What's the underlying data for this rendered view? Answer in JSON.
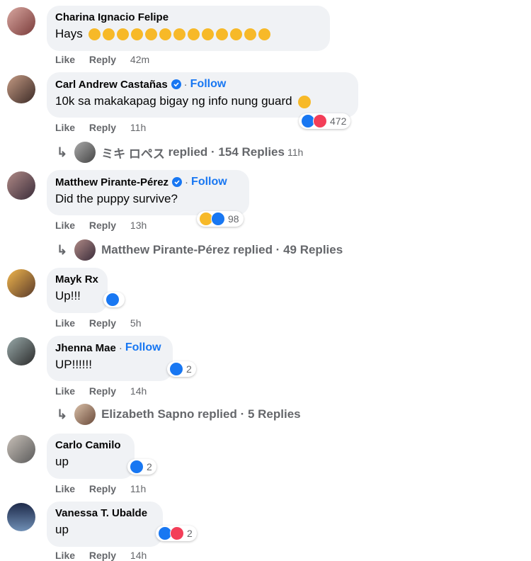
{
  "comments": [
    {
      "name": "Charina Ignacio Felipe",
      "verified": false,
      "follow": "",
      "text": "Hays",
      "emojis": 13,
      "like": "Like",
      "reply": "Reply",
      "time": "42m",
      "reactions": null,
      "replies": null
    },
    {
      "name": "Carl Andrew Castañas",
      "verified": true,
      "follow": "Follow",
      "text": "10k sa makakapag bigay ng info nung guard",
      "emojis": 1,
      "like": "Like",
      "reply": "Reply",
      "time": "11h",
      "reactions": "472",
      "replies": {
        "name": "ミキ ロペス",
        "label": "replied · 154 Replies",
        "time": "11h"
      }
    },
    {
      "name": "Matthew Pirante-Pérez",
      "verified": true,
      "follow": "Follow",
      "text": "Did the puppy survive?",
      "like": "Like",
      "reply": "Reply",
      "time": "13h",
      "reactions": "98",
      "replies": {
        "name": "Matthew Pirante-Pérez",
        "label": "replied · 49 Replies",
        "time": ""
      }
    },
    {
      "name": "Mayk Rx",
      "verified": false,
      "follow": "",
      "text": "Up!!!",
      "like": "Like",
      "reply": "Reply",
      "time": "5h",
      "reactions": "",
      "replies": null
    },
    {
      "name": "Jhenna Mae",
      "verified": false,
      "follow": "Follow",
      "text": "UP!!!!!!",
      "like": "Like",
      "reply": "Reply",
      "time": "14h",
      "reactions": "2",
      "replies": {
        "name": "Elizabeth Sapno",
        "label": "replied · 5 Replies",
        "time": ""
      }
    },
    {
      "name": "Carlo Camilo",
      "verified": false,
      "follow": "",
      "text": "up",
      "like": "Like",
      "reply": "Reply",
      "time": "11h",
      "reactions": "2",
      "replies": null
    },
    {
      "name": "Vanessa T. Ubalde",
      "verified": false,
      "follow": "",
      "text": "up",
      "like": "Like",
      "reply": "Reply",
      "time": "14h",
      "reactions": "2",
      "replies": null
    }
  ],
  "colors": {
    "accent": "#1877f2",
    "bubble": "#f0f2f5",
    "love": "#f33e58",
    "muted": "#65676b"
  },
  "icons": {
    "verified": "verified-badge-icon",
    "like": "like-reaction-icon",
    "love": "love-reaction-icon",
    "sad": "sad-reaction-icon",
    "reply_arrow": "reply-arrow-icon"
  }
}
